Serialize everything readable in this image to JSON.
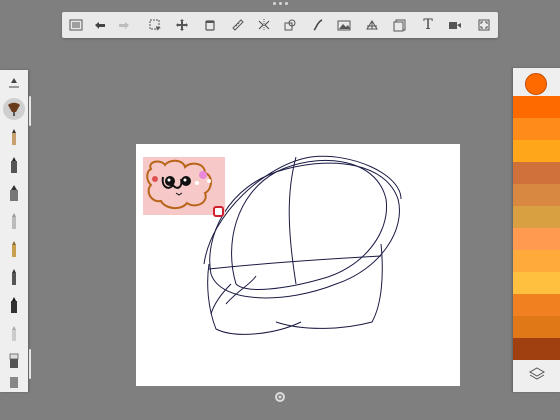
{
  "app": {
    "accent": "#ff6a00",
    "background": "#7f7f7f"
  },
  "toolbar": {
    "items": [
      {
        "name": "brush-library-button",
        "icon": "list-icon"
      },
      {
        "name": "undo-button",
        "icon": "undo-icon"
      },
      {
        "name": "redo-button",
        "icon": "redo-icon",
        "disabled": true
      },
      {
        "name": "selection-button",
        "icon": "selection-icon"
      },
      {
        "name": "transform-button",
        "icon": "move-icon"
      },
      {
        "name": "fill-button",
        "icon": "bucket-icon"
      },
      {
        "name": "ruler-button",
        "icon": "ruler-icon"
      },
      {
        "name": "symmetry-button",
        "icon": "symmetry-icon"
      },
      {
        "name": "stencil-button",
        "icon": "stencil-icon"
      },
      {
        "name": "curve-button",
        "icon": "curve-icon"
      },
      {
        "name": "image-button",
        "icon": "image-icon"
      },
      {
        "name": "perspective-button",
        "icon": "perspective-icon"
      },
      {
        "name": "flipbook-button",
        "icon": "flipbook-icon"
      },
      {
        "name": "text-button",
        "icon": "text-icon",
        "label": "T"
      },
      {
        "name": "video-button",
        "icon": "video-icon"
      },
      {
        "name": "fullscreen-button",
        "icon": "fullscreen-icon"
      }
    ]
  },
  "brushes": [
    {
      "name": "brush-slider",
      "icon": "slider-icon"
    },
    {
      "name": "brush-paint",
      "icon": "paintbrush-icon",
      "active": true
    },
    {
      "name": "brush-pencil",
      "icon": "pencil-icon"
    },
    {
      "name": "brush-marker",
      "icon": "marker-icon"
    },
    {
      "name": "brush-airbrush",
      "icon": "airbrush-icon"
    },
    {
      "name": "brush-crayon",
      "icon": "crayon-icon"
    },
    {
      "name": "brush-pen",
      "icon": "pen-icon"
    },
    {
      "name": "brush-ink",
      "icon": "ink-icon"
    },
    {
      "name": "brush-fineliner",
      "icon": "fineliner-icon"
    },
    {
      "name": "brush-chisel",
      "icon": "chisel-icon"
    },
    {
      "name": "brush-eraser",
      "icon": "eraser-icon"
    },
    {
      "name": "brush-blender",
      "icon": "blender-icon"
    }
  ],
  "colors": {
    "current": "#ff6a00",
    "swatches": [
      "#ff6a00",
      "#ff8c1a",
      "#ffa61a",
      "#d0703a",
      "#d88840",
      "#d8a040",
      "#ff9a50",
      "#ffaa3a",
      "#ffc040",
      "#f08020",
      "#e07818",
      "#a04010"
    ]
  },
  "layers": {
    "icon": "layers-icon"
  },
  "bottom": {
    "icon": "settings-icon"
  }
}
